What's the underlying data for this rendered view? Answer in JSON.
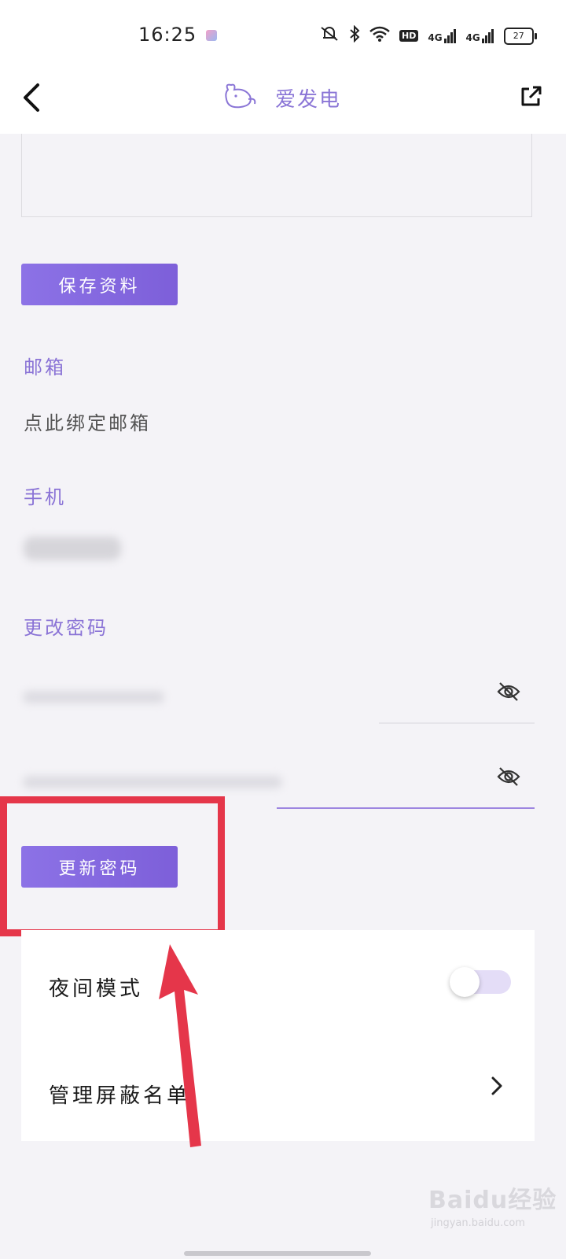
{
  "status_bar": {
    "time": "16:25",
    "network_1": "4G",
    "network_2": "4G",
    "hd_badge": "HD",
    "battery": "27"
  },
  "header": {
    "app_name": "爱发电"
  },
  "profile": {
    "save_button": "保存资料",
    "email_label": "邮箱",
    "email_value": "点此绑定邮箱",
    "phone_label": "手机",
    "password_label": "更改密码",
    "update_password_button": "更新密码"
  },
  "settings": {
    "night_mode_label": "夜间模式",
    "night_mode_on": false,
    "block_list_label": "管理屏蔽名单"
  },
  "watermark": {
    "text": "Baidu经验",
    "url": "jingyan.baidu.com"
  },
  "colors": {
    "accent": "#8a73d6",
    "highlight": "#e5364a",
    "background": "#f4f3f7"
  }
}
